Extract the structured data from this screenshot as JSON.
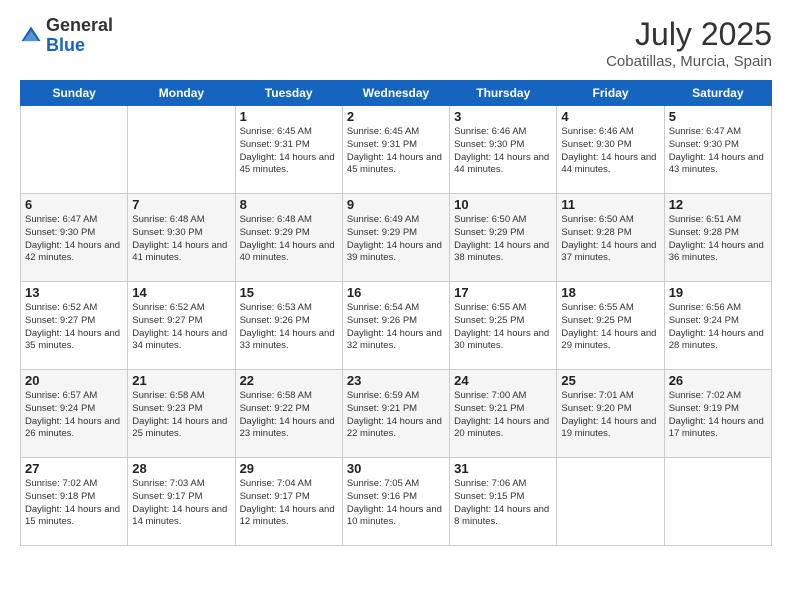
{
  "header": {
    "logo_general": "General",
    "logo_blue": "Blue",
    "month_year": "July 2025",
    "location": "Cobatillas, Murcia, Spain"
  },
  "weekdays": [
    "Sunday",
    "Monday",
    "Tuesday",
    "Wednesday",
    "Thursday",
    "Friday",
    "Saturday"
  ],
  "weeks": [
    [
      {
        "day": "",
        "info": ""
      },
      {
        "day": "",
        "info": ""
      },
      {
        "day": "1",
        "info": "Sunrise: 6:45 AM\nSunset: 9:31 PM\nDaylight: 14 hours\nand 45 minutes."
      },
      {
        "day": "2",
        "info": "Sunrise: 6:45 AM\nSunset: 9:31 PM\nDaylight: 14 hours\nand 45 minutes."
      },
      {
        "day": "3",
        "info": "Sunrise: 6:46 AM\nSunset: 9:30 PM\nDaylight: 14 hours\nand 44 minutes."
      },
      {
        "day": "4",
        "info": "Sunrise: 6:46 AM\nSunset: 9:30 PM\nDaylight: 14 hours\nand 44 minutes."
      },
      {
        "day": "5",
        "info": "Sunrise: 6:47 AM\nSunset: 9:30 PM\nDaylight: 14 hours\nand 43 minutes."
      }
    ],
    [
      {
        "day": "6",
        "info": "Sunrise: 6:47 AM\nSunset: 9:30 PM\nDaylight: 14 hours\nand 42 minutes."
      },
      {
        "day": "7",
        "info": "Sunrise: 6:48 AM\nSunset: 9:30 PM\nDaylight: 14 hours\nand 41 minutes."
      },
      {
        "day": "8",
        "info": "Sunrise: 6:48 AM\nSunset: 9:29 PM\nDaylight: 14 hours\nand 40 minutes."
      },
      {
        "day": "9",
        "info": "Sunrise: 6:49 AM\nSunset: 9:29 PM\nDaylight: 14 hours\nand 39 minutes."
      },
      {
        "day": "10",
        "info": "Sunrise: 6:50 AM\nSunset: 9:29 PM\nDaylight: 14 hours\nand 38 minutes."
      },
      {
        "day": "11",
        "info": "Sunrise: 6:50 AM\nSunset: 9:28 PM\nDaylight: 14 hours\nand 37 minutes."
      },
      {
        "day": "12",
        "info": "Sunrise: 6:51 AM\nSunset: 9:28 PM\nDaylight: 14 hours\nand 36 minutes."
      }
    ],
    [
      {
        "day": "13",
        "info": "Sunrise: 6:52 AM\nSunset: 9:27 PM\nDaylight: 14 hours\nand 35 minutes."
      },
      {
        "day": "14",
        "info": "Sunrise: 6:52 AM\nSunset: 9:27 PM\nDaylight: 14 hours\nand 34 minutes."
      },
      {
        "day": "15",
        "info": "Sunrise: 6:53 AM\nSunset: 9:26 PM\nDaylight: 14 hours\nand 33 minutes."
      },
      {
        "day": "16",
        "info": "Sunrise: 6:54 AM\nSunset: 9:26 PM\nDaylight: 14 hours\nand 32 minutes."
      },
      {
        "day": "17",
        "info": "Sunrise: 6:55 AM\nSunset: 9:25 PM\nDaylight: 14 hours\nand 30 minutes."
      },
      {
        "day": "18",
        "info": "Sunrise: 6:55 AM\nSunset: 9:25 PM\nDaylight: 14 hours\nand 29 minutes."
      },
      {
        "day": "19",
        "info": "Sunrise: 6:56 AM\nSunset: 9:24 PM\nDaylight: 14 hours\nand 28 minutes."
      }
    ],
    [
      {
        "day": "20",
        "info": "Sunrise: 6:57 AM\nSunset: 9:24 PM\nDaylight: 14 hours\nand 26 minutes."
      },
      {
        "day": "21",
        "info": "Sunrise: 6:58 AM\nSunset: 9:23 PM\nDaylight: 14 hours\nand 25 minutes."
      },
      {
        "day": "22",
        "info": "Sunrise: 6:58 AM\nSunset: 9:22 PM\nDaylight: 14 hours\nand 23 minutes."
      },
      {
        "day": "23",
        "info": "Sunrise: 6:59 AM\nSunset: 9:21 PM\nDaylight: 14 hours\nand 22 minutes."
      },
      {
        "day": "24",
        "info": "Sunrise: 7:00 AM\nSunset: 9:21 PM\nDaylight: 14 hours\nand 20 minutes."
      },
      {
        "day": "25",
        "info": "Sunrise: 7:01 AM\nSunset: 9:20 PM\nDaylight: 14 hours\nand 19 minutes."
      },
      {
        "day": "26",
        "info": "Sunrise: 7:02 AM\nSunset: 9:19 PM\nDaylight: 14 hours\nand 17 minutes."
      }
    ],
    [
      {
        "day": "27",
        "info": "Sunrise: 7:02 AM\nSunset: 9:18 PM\nDaylight: 14 hours\nand 15 minutes."
      },
      {
        "day": "28",
        "info": "Sunrise: 7:03 AM\nSunset: 9:17 PM\nDaylight: 14 hours\nand 14 minutes."
      },
      {
        "day": "29",
        "info": "Sunrise: 7:04 AM\nSunset: 9:17 PM\nDaylight: 14 hours\nand 12 minutes."
      },
      {
        "day": "30",
        "info": "Sunrise: 7:05 AM\nSunset: 9:16 PM\nDaylight: 14 hours\nand 10 minutes."
      },
      {
        "day": "31",
        "info": "Sunrise: 7:06 AM\nSunset: 9:15 PM\nDaylight: 14 hours\nand 8 minutes."
      },
      {
        "day": "",
        "info": ""
      },
      {
        "day": "",
        "info": ""
      }
    ]
  ]
}
